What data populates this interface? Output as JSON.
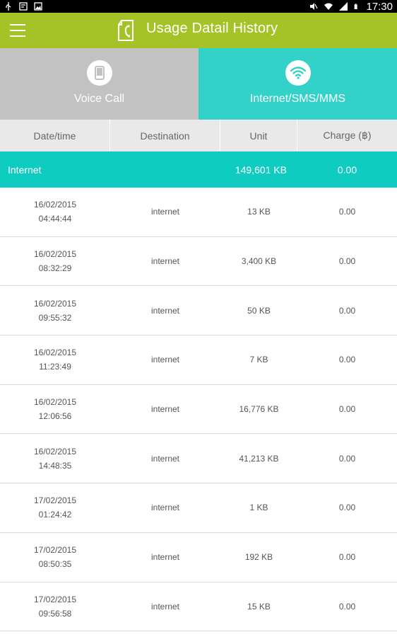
{
  "status_bar": {
    "time": "17:30",
    "left_icons": [
      "usb-icon",
      "sim-info-icon",
      "image-icon"
    ],
    "right_icons": [
      "mute-icon",
      "wifi-icon",
      "signal-icon",
      "battery-icon"
    ]
  },
  "app_bar": {
    "title": "Usage Datail History",
    "color": "#a5c227"
  },
  "tabs": [
    {
      "label": "Voice Call",
      "icon": "phone-icon",
      "selected": false,
      "color": "#c2c2c2"
    },
    {
      "label": "Internet/SMS/MMS",
      "icon": "wifi-icon",
      "selected": true,
      "color": "#33d2c8"
    }
  ],
  "columns": [
    "Date/time",
    "Destination",
    "Unit",
    "Charge (฿)"
  ],
  "summary": {
    "label": "Internet",
    "unit": "149,601 KB",
    "charge": "0.00",
    "color": "#0fccc0"
  },
  "rows": [
    {
      "date": "16/02/2015",
      "time": "04:44:44",
      "destination": "internet",
      "unit": "13 KB",
      "charge": "0.00"
    },
    {
      "date": "16/02/2015",
      "time": "08:32:29",
      "destination": "internet",
      "unit": "3,400 KB",
      "charge": "0.00"
    },
    {
      "date": "16/02/2015",
      "time": "09:55:32",
      "destination": "internet",
      "unit": "50 KB",
      "charge": "0.00"
    },
    {
      "date": "16/02/2015",
      "time": "11:23:49",
      "destination": "internet",
      "unit": "7 KB",
      "charge": "0.00"
    },
    {
      "date": "16/02/2015",
      "time": "12:06:56",
      "destination": "internet",
      "unit": "16,776 KB",
      "charge": "0.00"
    },
    {
      "date": "16/02/2015",
      "time": "14:48:35",
      "destination": "internet",
      "unit": "41,213 KB",
      "charge": "0.00"
    },
    {
      "date": "17/02/2015",
      "time": "01:24:42",
      "destination": "internet",
      "unit": "1 KB",
      "charge": "0.00"
    },
    {
      "date": "17/02/2015",
      "time": "08:50:35",
      "destination": "internet",
      "unit": "192 KB",
      "charge": "0.00"
    },
    {
      "date": "17/02/2015",
      "time": "09:56:58",
      "destination": "internet",
      "unit": "15 KB",
      "charge": "0.00"
    }
  ]
}
